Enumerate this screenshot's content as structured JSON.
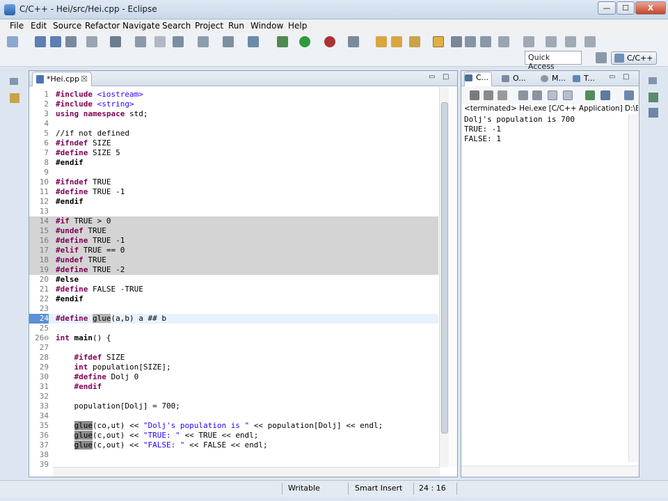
{
  "window": {
    "title": "C/C++ - Hei/src/Hei.cpp - Eclipse",
    "minimize_glyph": "—",
    "maximize_glyph": "☐",
    "close_glyph": "X"
  },
  "menu": [
    "File",
    "Edit",
    "Source",
    "Refactor",
    "Navigate",
    "Search",
    "Project",
    "Run",
    "Window",
    "Help"
  ],
  "toolbar": {
    "quick_access": "Quick Access",
    "perspective": "C/C++"
  },
  "editor": {
    "tab_label": "*Hei.cpp",
    "tab_close": "☒",
    "minimize_glyph": "▭",
    "maximize_glyph": "□",
    "lines": [
      "#include <iostream>",
      "#include <string>",
      "using namespace std;",
      "",
      "//if not defined",
      "#ifndef SIZE",
      "#define SIZE 5",
      "#endif",
      "",
      "#ifndef TRUE",
      "#define TRUE -1",
      "#endif",
      "",
      "#if TRUE > 0",
      "#undef TRUE",
      "#define TRUE -1",
      "#elif TRUE == 0",
      "#undef TRUE",
      "#define TRUE -2",
      "#else",
      "#define FALSE -TRUE",
      "#endif",
      "",
      "#define glue(a,b) a ## b",
      "",
      "int main() {",
      "",
      "    #ifdef SIZE",
      "    int population[SIZE];",
      "    #define Dolj 0",
      "    #endif",
      "",
      "    population[Dolj] = 700;",
      "",
      "    glue(co,ut) << \"Dolj's population is \" << population[Dolj] << endl;",
      "    glue(c,out) << \"TRUE: \" << TRUE << endl;",
      "    glue(c,out) << \"FALSE: \" << FALSE << endl;",
      "",
      ""
    ]
  },
  "console": {
    "tabs": [
      "C...",
      "O...",
      "M...",
      "T..."
    ],
    "minimize_glyph": "▭",
    "maximize_glyph": "□",
    "process_title": "<terminated> Hei.exe [C/C++ Application] D:\\Eclipse",
    "output": "Dolj's population is 700\nTRUE: -1\nFALSE: 1"
  },
  "status": {
    "writable": "Writable",
    "insert_mode": "Smart Insert",
    "position": "24 : 16"
  },
  "colors": {
    "keyword": "#7f0055",
    "string": "#2a00ff",
    "comment": "#3f7f5f",
    "disabled_block": "#d4d4d4"
  }
}
